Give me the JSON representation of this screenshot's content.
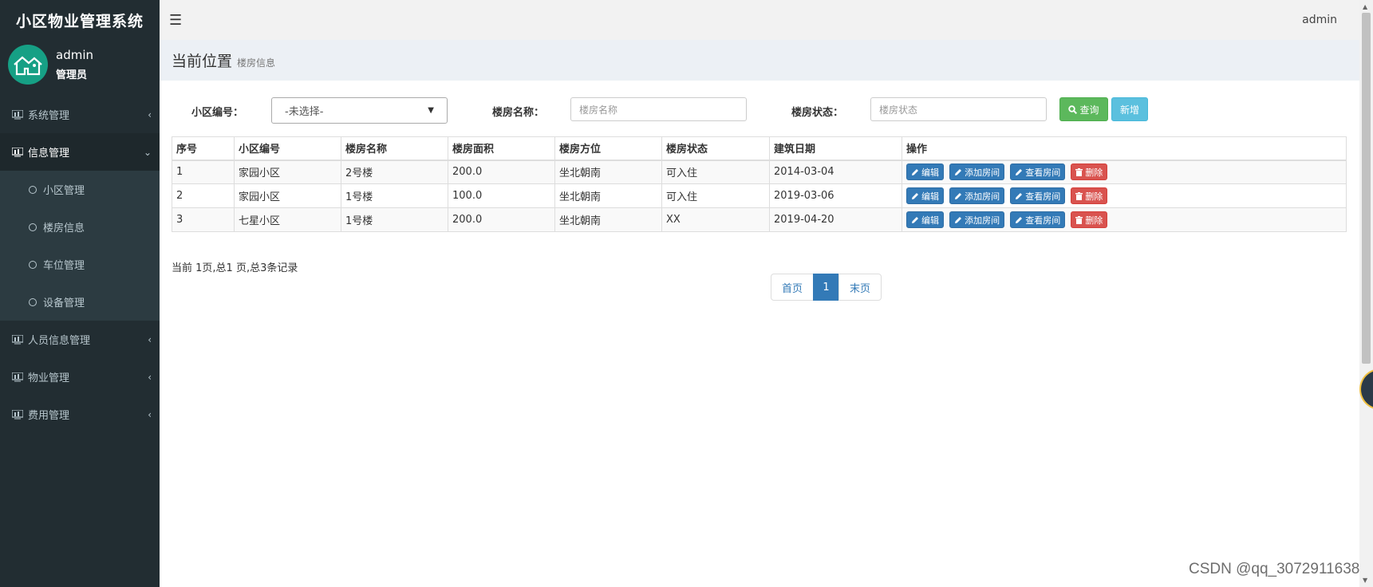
{
  "sidebar": {
    "brand": "小区物业管理系统",
    "user": {
      "name": "admin",
      "role": "管理员"
    },
    "menu": [
      {
        "label": "系统管理",
        "arrow": "‹"
      },
      {
        "label": "信息管理",
        "arrow": "⌄"
      },
      {
        "label": "人员信息管理",
        "arrow": "‹"
      },
      {
        "label": "物业管理",
        "arrow": "‹"
      },
      {
        "label": "费用管理",
        "arrow": "‹"
      }
    ],
    "submenu": [
      {
        "label": "小区管理"
      },
      {
        "label": "楼房信息"
      },
      {
        "label": "车位管理"
      },
      {
        "label": "设备管理"
      }
    ]
  },
  "header": {
    "menu_icon": "hamburger-icon",
    "user": "admin"
  },
  "breadcrumb": {
    "title": "当前位置",
    "current": "楼房信息"
  },
  "filter": {
    "community_label": "小区编号：",
    "community_selected": "-未选择-",
    "building_label": "楼房名称：",
    "building_placeholder": "楼房名称",
    "status_label": "楼房状态：",
    "status_placeholder": "楼房状态",
    "search_button": "查询",
    "add_button": "新增"
  },
  "table": {
    "headers": [
      "序号",
      "小区编号",
      "楼房名称",
      "楼房面积",
      "楼房方位",
      "楼房状态",
      "建筑日期",
      "操作"
    ],
    "actions": {
      "edit": "编辑",
      "add_room": "添加房间",
      "view_room": "查看房间",
      "delete": "删除"
    },
    "rows": [
      [
        "1",
        "家园小区",
        "2号楼",
        "200.0",
        "坐北朝南",
        "可入住",
        "2014-03-04"
      ],
      [
        "2",
        "家园小区",
        "1号楼",
        "100.0",
        "坐北朝南",
        "可入住",
        "2019-03-06"
      ],
      [
        "3",
        "七星小区",
        "1号楼",
        "200.0",
        "坐北朝南",
        "XX",
        "2019-04-20"
      ]
    ]
  },
  "pagination": {
    "info": "当前 1页,总1 页,总3条记录",
    "first": "首页",
    "current": "1",
    "last": "末页"
  },
  "watermark": "CSDN @qq_3072911638",
  "colors": {
    "sidebar": "#222d32",
    "primary": "#337ab7",
    "success": "#5cb85c",
    "info": "#5bc0de",
    "danger": "#d9534f",
    "avatar": "#16a085"
  }
}
